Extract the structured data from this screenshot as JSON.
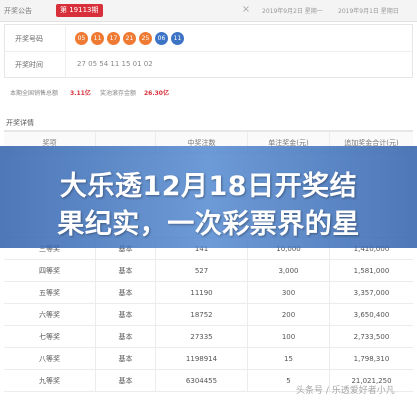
{
  "topbar": {
    "brand": "开奖公告",
    "issue_badge": "第 19113期",
    "close_glyph": "×",
    "date_left": "2019年9月2日 星期一",
    "date_right": "2019年9月1日 星期日"
  },
  "info": {
    "numbers_label": "开奖号码",
    "balls": [
      {
        "value": "05",
        "color": "red"
      },
      {
        "value": "11",
        "color": "red"
      },
      {
        "value": "17",
        "color": "red"
      },
      {
        "value": "21",
        "color": "red"
      },
      {
        "value": "25",
        "color": "red"
      },
      {
        "value": "06",
        "color": "blue"
      },
      {
        "value": "11",
        "color": "blue"
      }
    ],
    "time_label": "开奖时间",
    "time_value": "27 05 54 11 15 01 02"
  },
  "summary": {
    "sales_label": "本期全国销售总额",
    "sales_value": "3.11亿",
    "pool_label": "奖池滚存金额",
    "pool_value": "26.30亿"
  },
  "section_title": "开奖详情",
  "table": {
    "headers": [
      "奖项",
      "",
      "中奖注数",
      "单注奖金(元)",
      "追加奖金合计(元)"
    ],
    "rows": [
      [
        "三等奖",
        "基本",
        "141",
        "10,000",
        "1,410,000"
      ],
      [
        "四等奖",
        "基本",
        "527",
        "3,000",
        "1,581,000"
      ],
      [
        "五等奖",
        "基本",
        "11190",
        "300",
        "3,357,000"
      ],
      [
        "六等奖",
        "基本",
        "18752",
        "200",
        "3,650,400"
      ],
      [
        "七等奖",
        "基本",
        "27335",
        "100",
        "2,733,500"
      ],
      [
        "八等奖",
        "基本",
        "1198914",
        "15",
        "1,798,310"
      ],
      [
        "九等奖",
        "基本",
        "6304455",
        "5",
        "21,021,250"
      ]
    ]
  },
  "banner": {
    "line1": "大乐透12月18日开奖结",
    "line2": "果纪实，一次彩票界的星"
  },
  "watermark": "头条号 / 乐透爱好者小凡"
}
